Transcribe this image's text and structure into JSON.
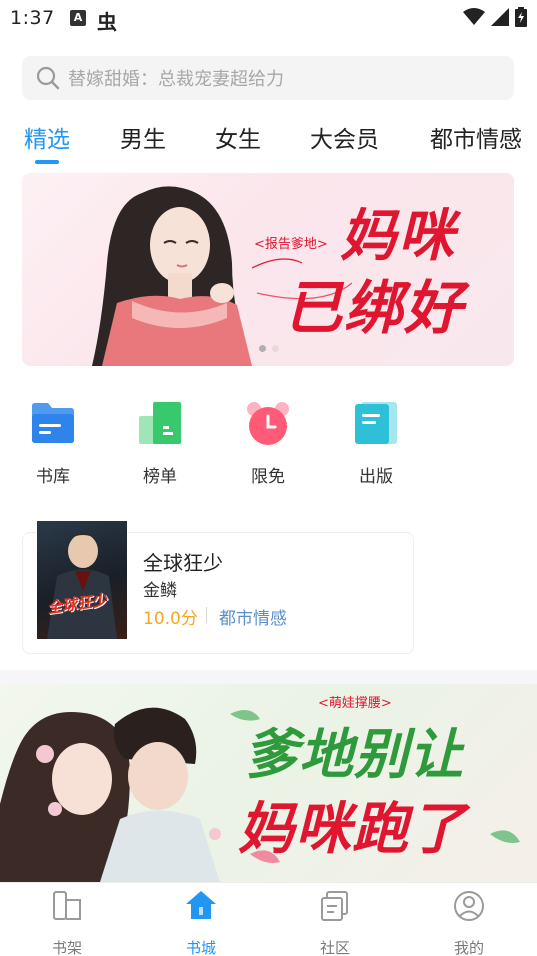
{
  "status_bar": {
    "time": "1:37",
    "notification_a": "A",
    "notification_bug": "虫"
  },
  "search": {
    "placeholder": "替嫁甜婚：总裁宠妻超给力"
  },
  "tabs": [
    {
      "label": "精选",
      "active": true
    },
    {
      "label": "男生",
      "active": false
    },
    {
      "label": "女生",
      "active": false
    },
    {
      "label": "大会员",
      "active": false
    },
    {
      "label": "都市情感",
      "active": false
    }
  ],
  "banner1": {
    "tag": "<报告爹地>",
    "title_line1": "妈咪",
    "title_line2": "已绑好"
  },
  "quick_menu": [
    {
      "label": "书库",
      "icon": "folder-icon"
    },
    {
      "label": "榜单",
      "icon": "ranking-icon"
    },
    {
      "label": "限免",
      "icon": "alarm-clock-icon"
    },
    {
      "label": "出版",
      "icon": "book-icon"
    }
  ],
  "book": {
    "title": "全球狂少",
    "author": "金鳞",
    "score": "10.0分",
    "genre": "都市情感",
    "cover_text": "全球狂少"
  },
  "banner2": {
    "tag": "<萌娃撑腰>",
    "title_line1": "爹地别让",
    "title_line2": "妈咪跑了"
  },
  "bottom_nav": [
    {
      "label": "书架",
      "icon": "bookshelf-icon",
      "active": false
    },
    {
      "label": "书城",
      "icon": "home-icon",
      "active": true
    },
    {
      "label": "社区",
      "icon": "community-icon",
      "active": false
    },
    {
      "label": "我的",
      "icon": "profile-icon",
      "active": false
    }
  ],
  "colors": {
    "accent": "#2196f3",
    "score": "#f5a623",
    "genre": "#5b8fc9",
    "banner_title": "#e0152f"
  }
}
